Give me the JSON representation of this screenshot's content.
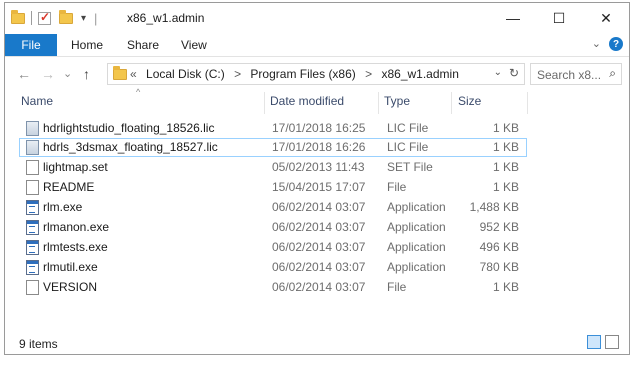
{
  "window": {
    "title": "x86_w1.admin",
    "controls": {
      "minimize": "—",
      "maximize": "☐",
      "close": "✕"
    },
    "qa_separator": "|"
  },
  "ribbon": {
    "tabs": [
      "File",
      "Home",
      "Share",
      "View"
    ],
    "help": "?"
  },
  "nav": {
    "back": "←",
    "forward": "→",
    "history": "⌄",
    "up": "↑",
    "crumbs_prefix": "«",
    "crumbs": [
      "Local Disk (C:)",
      "Program Files (x86)",
      "x86_w1.admin"
    ],
    "crumb_separator": ">",
    "search_placeholder": "Search x8..."
  },
  "columns": {
    "name": "Name",
    "date": "Date modified",
    "type": "Type",
    "size": "Size"
  },
  "files": [
    {
      "name": "hdrlightstudio_floating_18526.lic",
      "date": "17/01/2018 16:25",
      "type": "LIC File",
      "size": "1 KB",
      "icon": "lic-file-icon"
    },
    {
      "name": "hdrls_3dsmax_floating_18527.lic",
      "date": "17/01/2018 16:26",
      "type": "LIC File",
      "size": "1 KB",
      "icon": "lic-file-icon"
    },
    {
      "name": "lightmap.set",
      "date": "05/02/2013 11:43",
      "type": "SET File",
      "size": "1 KB",
      "icon": "generic-file-icon"
    },
    {
      "name": "README",
      "date": "15/04/2015 17:07",
      "type": "File",
      "size": "1 KB",
      "icon": "generic-file-icon"
    },
    {
      "name": "rlm.exe",
      "date": "06/02/2014 03:07",
      "type": "Application",
      "size": "1,488 KB",
      "icon": "application-icon"
    },
    {
      "name": "rlmanon.exe",
      "date": "06/02/2014 03:07",
      "type": "Application",
      "size": "952 KB",
      "icon": "application-icon"
    },
    {
      "name": "rlmtests.exe",
      "date": "06/02/2014 03:07",
      "type": "Application",
      "size": "496 KB",
      "icon": "application-icon"
    },
    {
      "name": "rlmutil.exe",
      "date": "06/02/2014 03:07",
      "type": "Application",
      "size": "780 KB",
      "icon": "application-icon"
    },
    {
      "name": "VERSION",
      "date": "06/02/2014 03:07",
      "type": "File",
      "size": "1 KB",
      "icon": "generic-file-icon"
    }
  ],
  "status": {
    "items": "9 items"
  },
  "colors": {
    "accent": "#1979ca",
    "selection_border": "#99d1ff"
  }
}
